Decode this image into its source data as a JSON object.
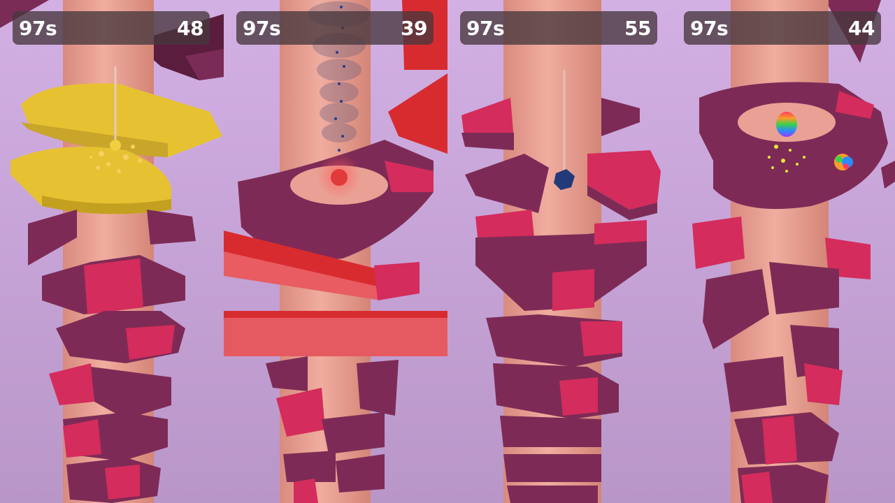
{
  "game": {
    "title": "",
    "panels": [
      {
        "id": "panel-1",
        "timer": "97s",
        "score": "48",
        "ball": "yellow-splash-ball",
        "platform_colors": {
          "base": "#7d2b56",
          "danger": "#d42c5c",
          "active": "#e6c232"
        }
      },
      {
        "id": "panel-2",
        "timer": "97s",
        "score": "39",
        "ball": "red-ball",
        "platform_colors": {
          "base": "#7d2b56",
          "danger": "#d42c5c",
          "active": "#e0424b"
        }
      },
      {
        "id": "panel-3",
        "timer": "97s",
        "score": "55",
        "ball": "blue-cube-ball",
        "platform_colors": {
          "base": "#7d2b56",
          "danger": "#d42c5c"
        }
      },
      {
        "id": "panel-4",
        "timer": "97s",
        "score": "44",
        "ball": "rainbow-ball",
        "platform_colors": {
          "base": "#7d2b56",
          "danger": "#d42c5c"
        }
      }
    ],
    "colors": {
      "background": "#c9a9d9",
      "pole": "#e9a195",
      "hud_bg": "#46373c",
      "hud_text": "#ffffff"
    }
  }
}
